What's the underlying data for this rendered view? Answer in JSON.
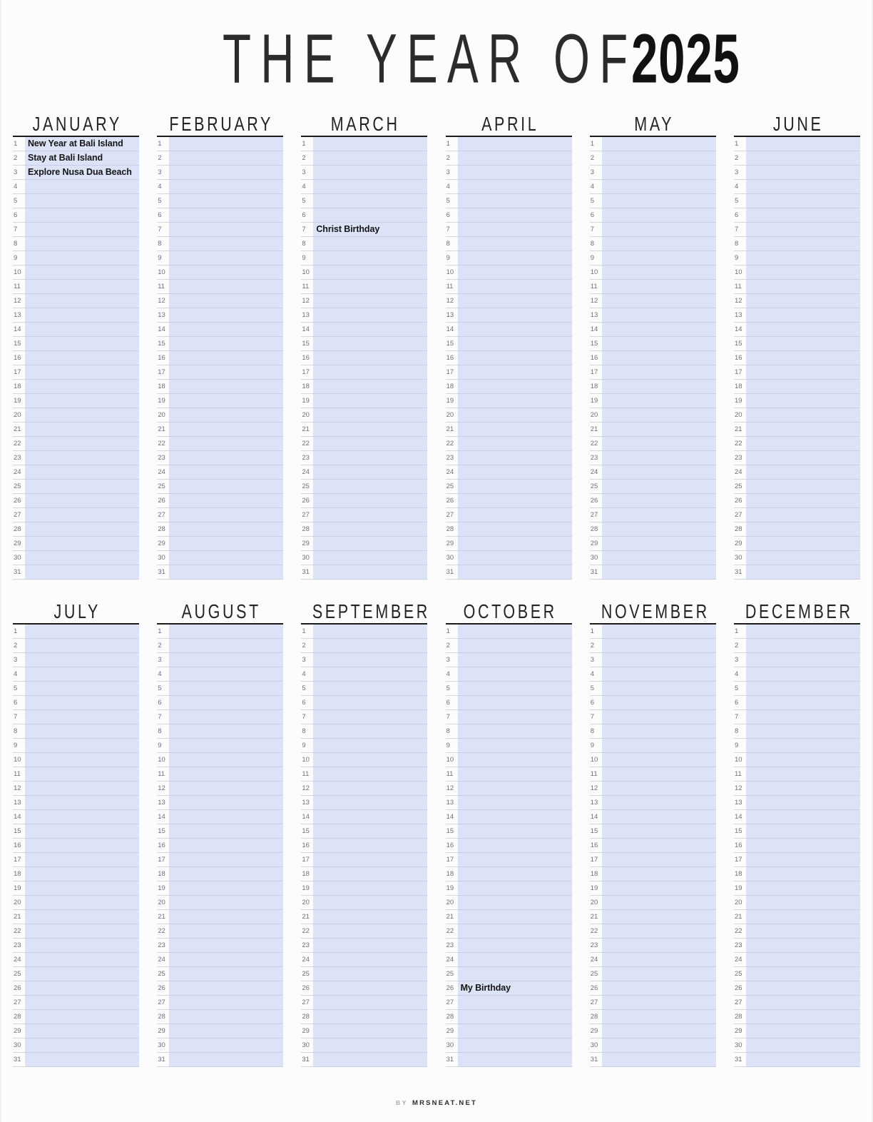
{
  "title": {
    "prefix": "THE YEAR OF",
    "year": "2025"
  },
  "colors": {
    "page_background": "#fcfcfc",
    "row_fill": "#dde3f7",
    "row_divider": "#c9cfe6",
    "month_rule": "#1c1c1c",
    "day_number": "#6e7179",
    "entry_text": "#151515",
    "title_text": "#2b2b2b"
  },
  "layout": {
    "columns_per_row": 6,
    "rows_per_month": 31
  },
  "months": [
    {
      "name": "JANUARY",
      "entries": {
        "1": "New Year at Bali Island",
        "2": "Stay at Bali Island",
        "3": "Explore Nusa Dua Beach"
      }
    },
    {
      "name": "FEBRUARY",
      "entries": {}
    },
    {
      "name": "MARCH",
      "entries": {
        "7": "Christ Birthday"
      }
    },
    {
      "name": "APRIL",
      "entries": {}
    },
    {
      "name": "MAY",
      "entries": {}
    },
    {
      "name": "JUNE",
      "entries": {}
    },
    {
      "name": "JULY",
      "entries": {}
    },
    {
      "name": "AUGUST",
      "entries": {}
    },
    {
      "name": "SEPTEMBER",
      "entries": {}
    },
    {
      "name": "OCTOBER",
      "entries": {
        "26": "My Birthday"
      }
    },
    {
      "name": "NOVEMBER",
      "entries": {}
    },
    {
      "name": "DECEMBER",
      "entries": {}
    }
  ],
  "footer": {
    "by_label": "BY",
    "site": "MRSNEAT.NET"
  }
}
